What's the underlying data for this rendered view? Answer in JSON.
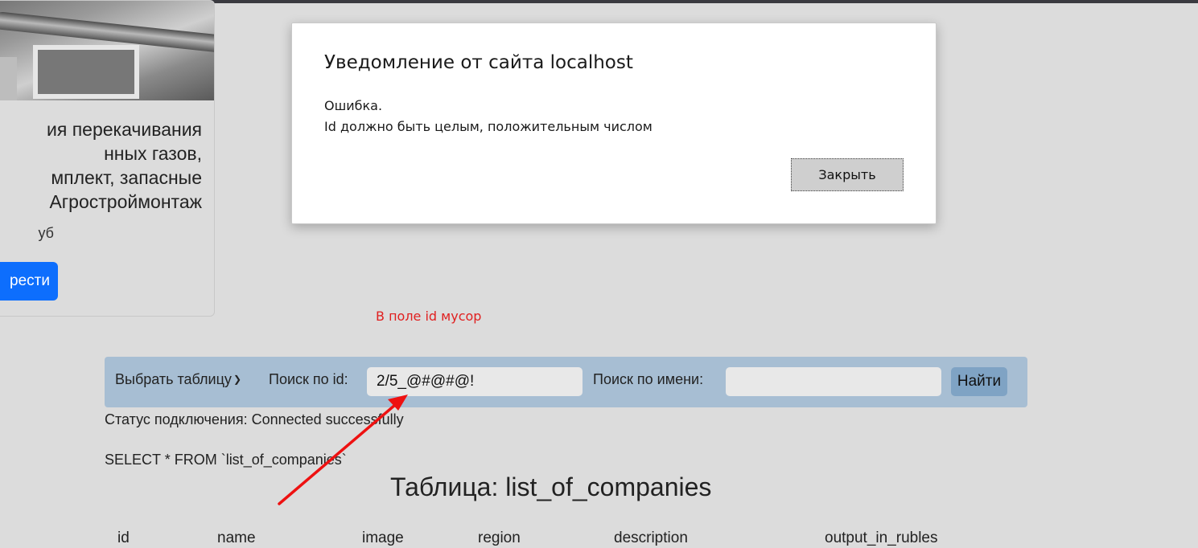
{
  "card": {
    "title_lines": [
      "ия перекачивания",
      "нных газов,",
      "мплект, запасные",
      " Агростроймонтаж"
    ],
    "price": "уб",
    "button_label": "рести"
  },
  "annotation": "В поле id мусор",
  "search": {
    "select_label": "Выбрать таблицу",
    "id_label": "Поиск по id:",
    "id_value": "2/5_@#@#@!",
    "name_label": "Поиск по имени:",
    "name_value": "",
    "find_label": "Найти"
  },
  "status": "Статус подключения: Connected successfully",
  "query": "SELECT * FROM `list_of_companies`",
  "table": {
    "title": "Таблица: list_of_companies",
    "columns": [
      "id",
      "name",
      "image",
      "region",
      "description",
      "output_in_rubles"
    ]
  },
  "dialog": {
    "title": "Уведомление от сайта localhost",
    "message_line1": "Ошибка.",
    "message_line2": "Id должно быть целым, положительным числом",
    "close_label": "Закрыть"
  },
  "colors": {
    "accent_button": "#0d6efd",
    "searchbar_bg": "#a7bed3",
    "annotation": "#e02020"
  }
}
